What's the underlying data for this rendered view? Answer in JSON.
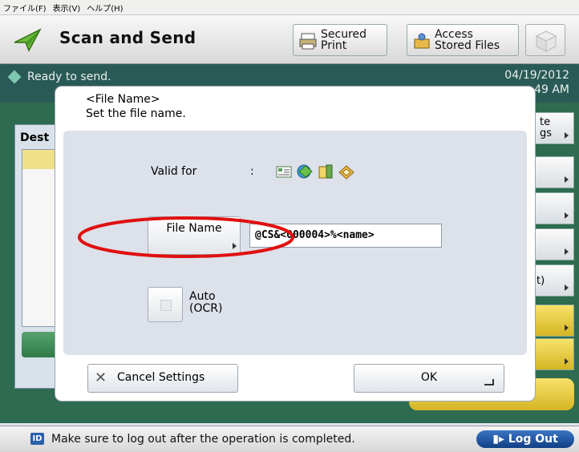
{
  "menubar": {
    "items": [
      "ファイル(F)",
      "表示(V)",
      "ヘルプ(H)"
    ]
  },
  "header": {
    "title": "Scan and Send",
    "secured_print": "Secured\nPrint",
    "access_files": "Access\nStored Files"
  },
  "status": {
    "message": "Ready to send.",
    "date": "04/19/2012",
    "time": "49 AM"
  },
  "background": {
    "left_title": "Dest",
    "right_partial_1": "te",
    "right_partial_2": "gs",
    "right_partial_3": "t)"
  },
  "dialog": {
    "title": "<File Name>",
    "subtitle": "Set the file name.",
    "valid_for_label": "Valid for",
    "valid_for_colon": ":",
    "valid_icons": [
      "email-icon",
      "ifax-icon",
      "file-server-icon",
      "mail-box-icon"
    ],
    "file_name_button": "File Name",
    "file_name_value": "@CS&<000004>%<name>",
    "auto_ocr_label": "Auto\n(OCR)",
    "cancel_label": "Cancel Settings",
    "ok_label": "OK"
  },
  "footer": {
    "id_badge": "ID",
    "message": "Make sure to log out after the operation is completed.",
    "logout_label": "Log Out"
  },
  "colors": {
    "status_bar": "#2a5a55",
    "annotation_circle": "#e01010",
    "logout": "#2a61a8"
  }
}
